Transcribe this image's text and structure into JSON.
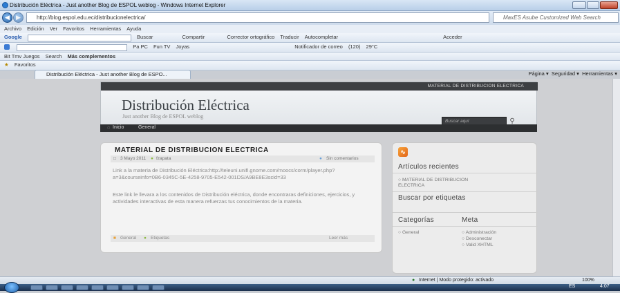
{
  "window": {
    "title": "Distribución Eléctrica - Just another Blog de ESPOL weblog - Windows Internet Explorer",
    "url": "http://blog.espol.edu.ec/distribucionelectrica/",
    "search_placeholder": "MaxES Asube Customized Web Search"
  },
  "menu": [
    "Archivo",
    "Edición",
    "Ver",
    "Favoritos",
    "Herramientas",
    "Ayuda"
  ],
  "toolbar1": {
    "brand": "Google",
    "search_label": "Buscar",
    "share_label": "Compartir",
    "spell_label": "Corrector ortográfico",
    "translate_label": "Traducir",
    "autofill_label": "Autocompletar",
    "more_label": "Acceder"
  },
  "toolbar2": {
    "items": [
      "Pa PC",
      "Fun TV",
      "Joyas",
      "Notificador de correo",
      "(120)",
      "29°C"
    ]
  },
  "favbar": {
    "items": [
      "Bit Tmv Juegos",
      "Search",
      "Más complementos"
    ]
  },
  "tab": {
    "label": "Distribución Eléctrica - Just another Blog de ESPO..."
  },
  "favorites_label": "Favoritos",
  "command_bar": {
    "items": [
      "Página",
      "Seguridad",
      "Herramientas"
    ]
  },
  "blog": {
    "top_strip": "MATERIAL DE DISTRIBUCION ELECTRICA",
    "title": "Distribución Eléctrica",
    "subtitle": "Just another Blog de ESPOL weblog",
    "search_placeholder": "Buscar aquí",
    "nav": [
      "Inicio",
      "General"
    ]
  },
  "post": {
    "title": "MATERIAL DE DISTRIBUCION ELECTRICA",
    "date": "3 Mayo 2011",
    "author": "fzapata",
    "comments": "Sin comentarios",
    "link_text": "Link a la materia de Distribución Eléctrica:http://teleuni.unifi.gnome.com/moocs/corm/player.php?a=3&courseinfo=0B6-0345C-5E-4258-9705-E542-001DS/A9BE8E3scid=33",
    "body": "Este link le llevara a los contenidos de Distribución eléctrica, donde encontraras definiciones, ejercicios, y actividades interactivas de esta manera refuerzas tus conocimientos de la materia.",
    "category": "General",
    "tags_label": "Etiquetas",
    "read_more": "Leer más"
  },
  "sidebar": {
    "recent_title": "Artículos recientes",
    "recent_items": [
      "MATERIAL DE DISTRIBUCION ELECTRICA"
    ],
    "tags_title": "Buscar por etiquetas",
    "categories_title": "Categorías",
    "categories": [
      "General"
    ],
    "meta_title": "Meta",
    "meta": [
      "Administración",
      "Desconectar",
      "Valid XHTML"
    ]
  },
  "status": {
    "zone": "Internet | Modo protegido: activado",
    "zoom": "100%"
  },
  "taskbar": {
    "lang": "ES",
    "time": "4:07"
  }
}
